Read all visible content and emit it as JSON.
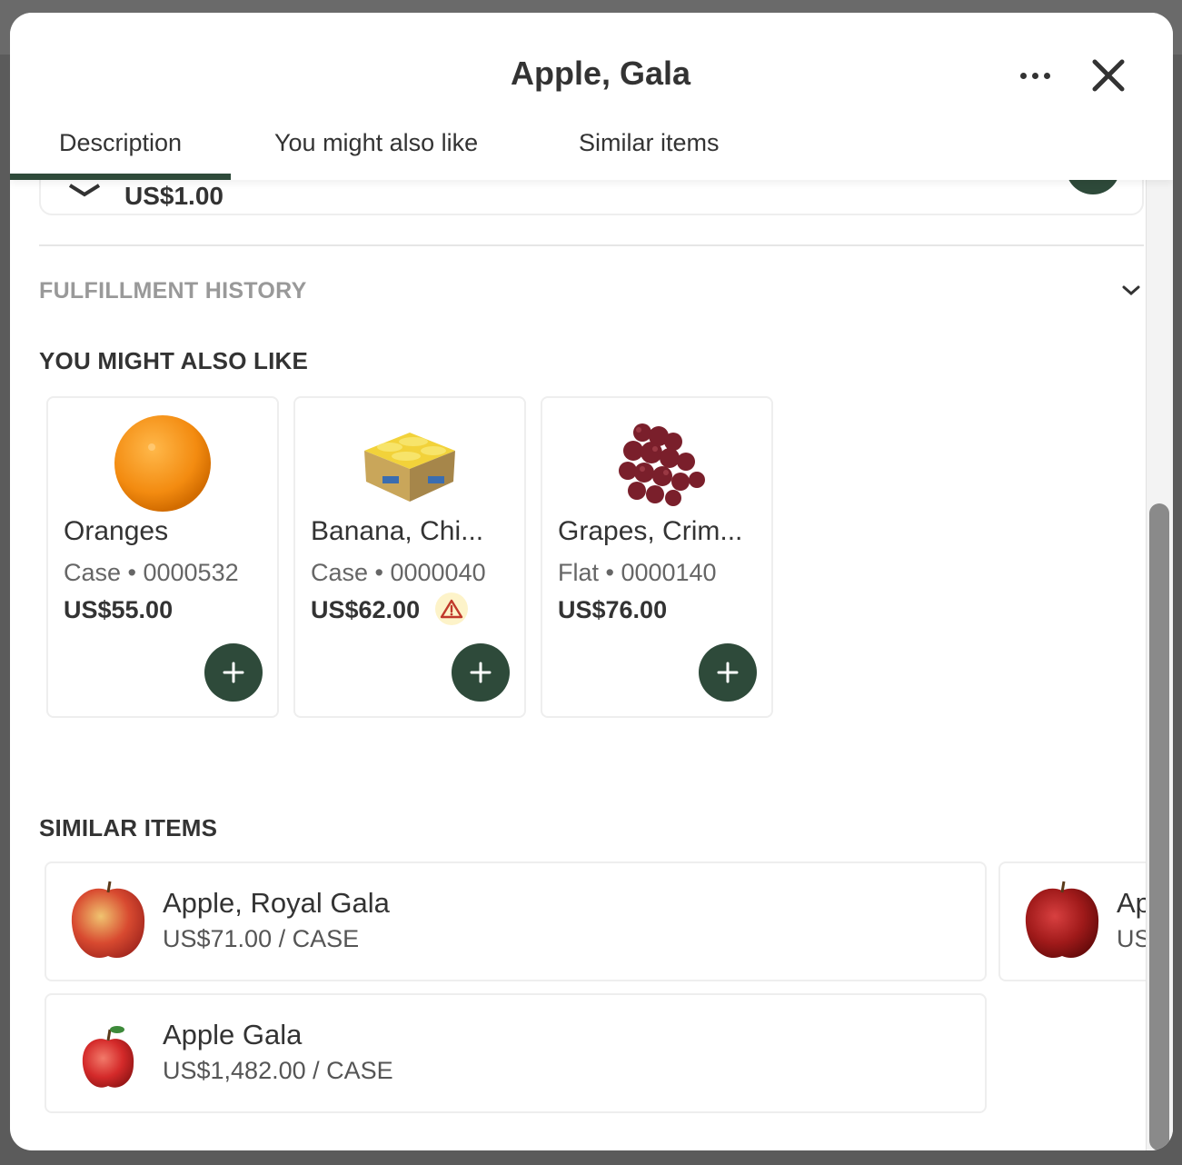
{
  "modal": {
    "title": "Apple, Gala",
    "tabs": [
      {
        "label": "Description",
        "active": true
      },
      {
        "label": "You might also like",
        "active": false
      },
      {
        "label": "Similar items",
        "active": false
      }
    ],
    "icons": {
      "more": "more-horizontal-icon",
      "close": "close-icon"
    }
  },
  "previous_card": {
    "price_partial": "US$1.00"
  },
  "fulfillment": {
    "title": "FULFILLMENT HISTORY"
  },
  "you_might_also_like": {
    "title": "YOU MIGHT ALSO LIKE",
    "items": [
      {
        "name": "Oranges",
        "meta": "Case • 0000532",
        "price": "US$55.00",
        "warning": false
      },
      {
        "name": "Banana, Chi...",
        "meta": "Case • 0000040",
        "price": "US$62.00",
        "warning": true
      },
      {
        "name": "Grapes, Crim...",
        "meta": "Flat • 0000140",
        "price": "US$76.00",
        "warning": false
      }
    ]
  },
  "similar_items": {
    "title": "SIMILAR ITEMS",
    "items": [
      {
        "name": "Apple, Royal Gala",
        "price": "US$71.00 / CASE"
      },
      {
        "name": "Apple Gala",
        "price": "US$1,482.00 / CASE"
      },
      {
        "name": "Ap",
        "price": "US"
      }
    ]
  },
  "colors": {
    "accent": "#2e4a3a",
    "warning_bg": "#fdf3c9",
    "warning": "#c0392b"
  }
}
